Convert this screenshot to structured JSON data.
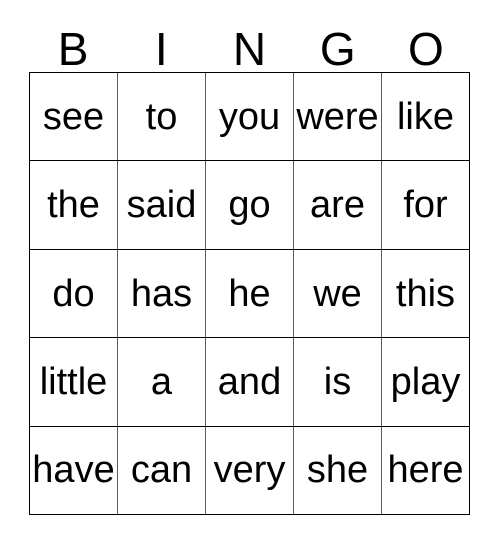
{
  "card": {
    "title": "BINGO",
    "header_letters": [
      "B",
      "I",
      "N",
      "G",
      "O"
    ],
    "grid": {
      "columns": 5,
      "rows": 5,
      "border_color": "#000000",
      "inner_line_color": "#5a5a5a",
      "background_color": "#ffffff",
      "text_color": "#000000",
      "cells": [
        [
          {
            "word": "see"
          },
          {
            "word": "to"
          },
          {
            "word": "you"
          },
          {
            "word": "were"
          },
          {
            "word": "like"
          }
        ],
        [
          {
            "word": "the"
          },
          {
            "word": "said"
          },
          {
            "word": "go"
          },
          {
            "word": "are"
          },
          {
            "word": "for"
          }
        ],
        [
          {
            "word": "do"
          },
          {
            "word": "has"
          },
          {
            "word": "he"
          },
          {
            "word": "we"
          },
          {
            "word": "this"
          }
        ],
        [
          {
            "word": "little"
          },
          {
            "word": "a"
          },
          {
            "word": "and"
          },
          {
            "word": "is"
          },
          {
            "word": "play"
          }
        ],
        [
          {
            "word": "have"
          },
          {
            "word": "can"
          },
          {
            "word": "very"
          },
          {
            "word": "she"
          },
          {
            "word": "here"
          }
        ]
      ]
    }
  }
}
